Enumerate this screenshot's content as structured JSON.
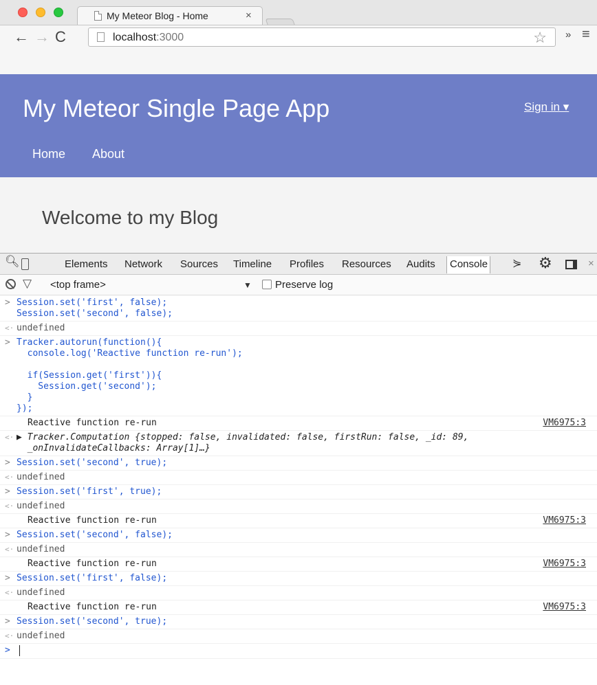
{
  "browser": {
    "tab_title": "My Meteor Blog - Home",
    "tab_close": "×",
    "url_host": "localhost",
    "url_port": ":3000",
    "back_icon": "←",
    "forward_icon": "→",
    "reload_icon": "C",
    "star_icon": "☆",
    "extensions_chevron": "»",
    "menu_icon": "≡"
  },
  "app": {
    "brand": "My Meteor Single Page App",
    "signin": "Sign in ▾",
    "nav": [
      "Home",
      "About"
    ],
    "welcome": "Welcome to my Blog"
  },
  "devtools": {
    "tabs": [
      "Elements",
      "Network",
      "Sources",
      "Timeline",
      "Profiles",
      "Resources",
      "Audits",
      "Console"
    ],
    "active_tab": "Console",
    "close": "×",
    "frame_selector": "<top frame>",
    "frame_caret": "▼",
    "preserve_log": "Preserve log"
  },
  "console": {
    "entries": [
      {
        "kind": "in",
        "text": "Session.set('first', false);\nSession.set('second', false);"
      },
      {
        "kind": "out",
        "text": "undefined"
      },
      {
        "kind": "in",
        "text": "Tracker.autorun(function(){\n  console.log('Reactive function re-run');\n\n  if(Session.get('first')){\n    Session.get('second');\n  }\n});"
      },
      {
        "kind": "log",
        "text": "Reactive function re-run",
        "src": "VM6975:3"
      },
      {
        "kind": "obj",
        "text": "▶ Tracker.Computation {stopped: false, invalidated: false, firstRun: false, _id: 89,\n  _onInvalidateCallbacks: Array[1]…}"
      },
      {
        "kind": "in",
        "text": "Session.set('second', true);"
      },
      {
        "kind": "out",
        "text": "undefined"
      },
      {
        "kind": "in",
        "text": "Session.set('first', true);"
      },
      {
        "kind": "out",
        "text": "undefined"
      },
      {
        "kind": "log",
        "text": "Reactive function re-run",
        "src": "VM6975:3"
      },
      {
        "kind": "in",
        "text": "Session.set('second', false);"
      },
      {
        "kind": "out",
        "text": "undefined"
      },
      {
        "kind": "log",
        "text": "Reactive function re-run",
        "src": "VM6975:3"
      },
      {
        "kind": "in",
        "text": "Session.set('first', false);"
      },
      {
        "kind": "out",
        "text": "undefined"
      },
      {
        "kind": "log",
        "text": "Reactive function re-run",
        "src": "VM6975:3"
      },
      {
        "kind": "in",
        "text": "Session.set('second', true);"
      },
      {
        "kind": "out",
        "text": "undefined"
      }
    ],
    "input_prompt": ">",
    "in_gutter": ">",
    "out_gutter": "<·"
  }
}
